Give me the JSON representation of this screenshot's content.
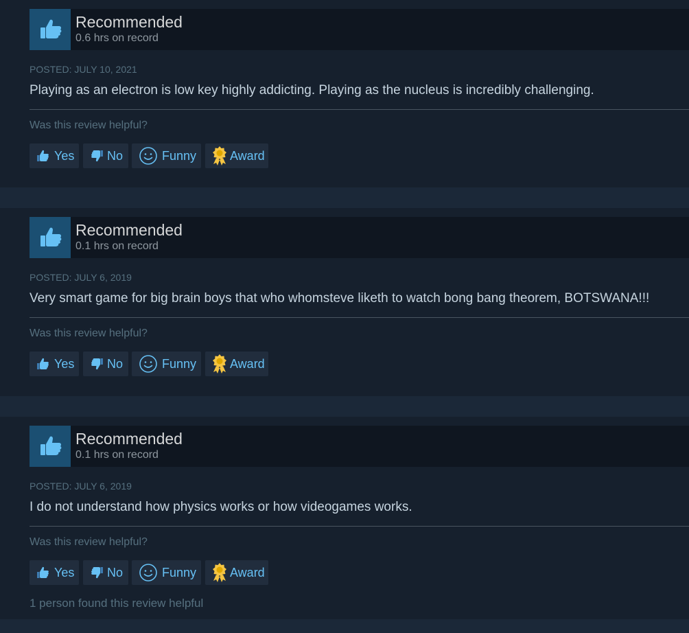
{
  "colors": {
    "page_bg": "#1b2838",
    "card_bg": "#16202d",
    "header_bg": "#0f1620",
    "thumb_bg": "#1b4f72",
    "accent": "#66c0f4",
    "award_gold": "#f5c542"
  },
  "helpful_prompt": "Was this review helpful?",
  "buttons": {
    "yes": "Yes",
    "no": "No",
    "funny": "Funny",
    "award": "Award"
  },
  "icons": {
    "verdict": "thumbs-up-icon",
    "yes": "thumbs-up-icon",
    "no": "thumbs-down-icon",
    "funny": "smiley-icon",
    "award": "award-icon"
  },
  "reviews": [
    {
      "verdict": "Recommended",
      "hours": "0.6 hrs on record",
      "posted": "POSTED: JULY 10, 2021",
      "content": "Playing as an electron is low key highly addicting. Playing as the nucleus is incredibly challenging."
    },
    {
      "verdict": "Recommended",
      "hours": "0.1 hrs on record",
      "posted": "POSTED: JULY 6, 2019",
      "content": "Very smart game for big brain boys that who whomsteve liketh to watch bong bang theorem, BOTSWANA!!!"
    },
    {
      "verdict": "Recommended",
      "hours": "0.1 hrs on record",
      "posted": "POSTED: JULY 6, 2019",
      "content": "I do not understand how physics works or how videogames works.",
      "helpful_count": "1 person found this review helpful"
    }
  ]
}
